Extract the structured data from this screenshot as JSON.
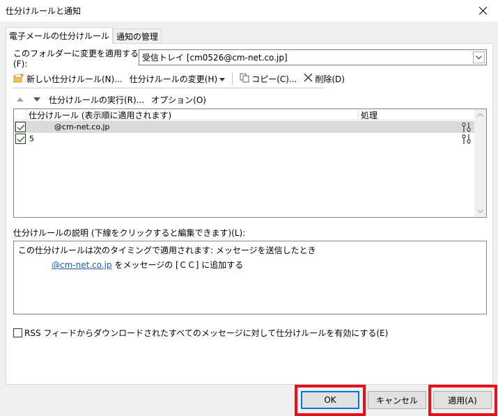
{
  "window": {
    "title": "仕分けルールと通知"
  },
  "tabs": [
    {
      "label": "電子メールの仕分けルール",
      "active": true
    },
    {
      "label": "通知の管理",
      "active": false
    }
  ],
  "folder": {
    "label": "このフォルダーに変更を適用する(F):",
    "value": "受信トレイ [cm0526@cm-net.co.jp]"
  },
  "toolbar": {
    "new_rule": "新しい仕分けルール(N)...",
    "change_rule": "仕分けルールの変更(H)",
    "copy": "コピー(C)...",
    "delete": "削除(D)"
  },
  "row2": {
    "run_rules": "仕分けルールの実行(R)...",
    "options": "オプション(O)"
  },
  "list": {
    "col_rule": "仕分けルール (表示順に適用されます)",
    "col_action": "処理",
    "rows": [
      {
        "name": "@cm-net.co.jp",
        "checked": true,
        "selected": true
      },
      {
        "name": "5",
        "checked": true,
        "selected": false
      }
    ]
  },
  "description": {
    "label": "仕分けルールの説明 (下線をクリックすると編集できます)(L):",
    "line1": "この仕分けルールは次のタイミングで適用されます: メッセージを送信したとき",
    "line2_link": "@cm-net.co.jp",
    "line2_rest": " をメッセージの [ＣＣ] に追加する"
  },
  "rss": {
    "label": "RSS フィードからダウンロードされたすべてのメッセージに対して仕分けルールを有効にする(E)",
    "checked": false
  },
  "buttons": {
    "ok": "OK",
    "cancel": "キャンセル",
    "apply": "適用(A)"
  },
  "colors": {
    "highlight_box": "#e8101a",
    "link": "#1a5fb4",
    "default_button_border": "#0078d7",
    "check": "#2b7a2b"
  }
}
